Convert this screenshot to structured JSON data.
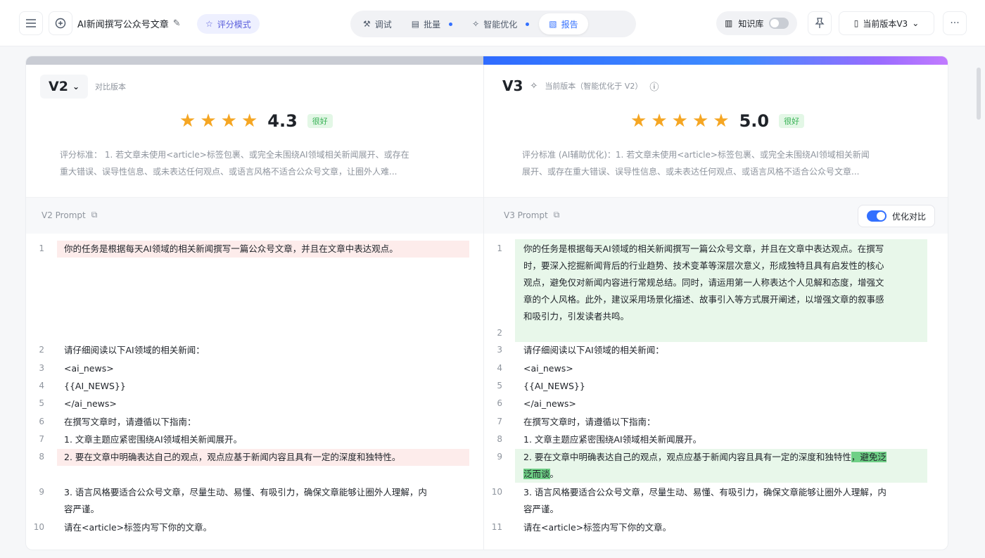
{
  "topbar": {
    "title": "AI新闻撰写公众号文章",
    "eval_mode": "评分模式",
    "tabs": [
      {
        "label": "调试",
        "dot": false
      },
      {
        "label": "批量",
        "dot": true
      },
      {
        "label": "智能优化",
        "dot": true
      },
      {
        "label": "报告",
        "dot": false
      }
    ],
    "knowledge_base": "知识库",
    "version_select": "当前版本V3"
  },
  "left": {
    "version": "V2",
    "sublabel": "对比版本",
    "score": "4.3",
    "badge": "很好",
    "criteria_line1": "评分标准：  1. 若文章未使用<article>标签包裹、或完全未围绕AI领域相关新闻展开、或存在",
    "criteria_line2": "重大错误、误导性信息、或未表达任何观点、或语言风格不适合公众号文章，让圈外人难...",
    "prompt_label": "V2 Prompt",
    "lines": [
      {
        "n": "1",
        "t": "你的任务是根据每天AI领域的相关新闻撰写一篇公众号文章，并且在文章中表达观点。"
      },
      {
        "n": "2",
        "t": "请仔细阅读以下AI领域的相关新闻："
      },
      {
        "n": "3",
        "t": "<ai_news>"
      },
      {
        "n": "4",
        "t": "{{AI_NEWS}}"
      },
      {
        "n": "5",
        "t": "</ai_news>"
      },
      {
        "n": "6",
        "t": "在撰写文章时，请遵循以下指南："
      },
      {
        "n": "7",
        "t": "1. 文章主题应紧密围绕AI领域相关新闻展开。"
      },
      {
        "n": "8",
        "t": "2. 要在文章中明确表达自己的观点，观点应基于新闻内容且具有一定的深度和独特性。"
      },
      {
        "n": "9",
        "t": "3. 语言风格要适合公众号文章，尽量生动、易懂、有吸引力，确保文章能够让圈外人理解，内",
        "t2": "容严谨。"
      },
      {
        "n": "10",
        "t": "请在<article>标签内写下你的文章。"
      }
    ]
  },
  "right": {
    "version": "V3",
    "sublabel": "当前版本（智能优化于 V2）",
    "score": "5.0",
    "badge": "很好",
    "criteria_line1": "评分标准 (AI辅助优化)：1. 若文章未使用<article>标签包裹、或完全未围绕AI领域相关新闻",
    "criteria_line2": "展开、或存在重大错误、误导性信息、或未表达任何观点、或语言风格不适合公众号文章...",
    "prompt_label": "V3 Prompt",
    "compare_label": "优化对比",
    "line1": [
      "你的任务是根据每天AI领域的相关新闻撰写一篇公众号文章，并且在文章中表达观点。在撰写",
      "时，要深入挖掘新闻背后的行业趋势、技术变革等深层次意义，形成独特且具有启发性的核心",
      "观点，避免仅对新闻内容进行常规总结。同时，请运用第一人称表达个人见解和态度，增强文",
      "章的个人风格。此外，建议采用场景化描述、故事引入等方式展开阐述，以增强文章的叙事感",
      "和吸引力，引发读者共鸣。"
    ],
    "lines": [
      {
        "n": "3",
        "t": "请仔细阅读以下AI领域的相关新闻："
      },
      {
        "n": "4",
        "t": "<ai_news>"
      },
      {
        "n": "5",
        "t": "{{AI_NEWS}}"
      },
      {
        "n": "6",
        "t": "</ai_news>"
      },
      {
        "n": "7",
        "t": "在撰写文章时，请遵循以下指南："
      },
      {
        "n": "8",
        "t": "1. 文章主题应紧密围绕AI领域相关新闻展开。"
      }
    ],
    "line9_a": "2. 要在文章中明确表达自己的观点，观点应基于新闻内容且具有一定的深度和独特性",
    "line9_b": "，避免泛",
    "line9_c": "泛而谈",
    "line9_d": "。",
    "line10_a": "3. 语言风格要适合公众号文章，尽量生动、易懂、有吸引力，确保文章能够让圈外人理解，内",
    "line10_b": "容严谨。",
    "line11": "请在<article>标签内写下你的文章。"
  }
}
